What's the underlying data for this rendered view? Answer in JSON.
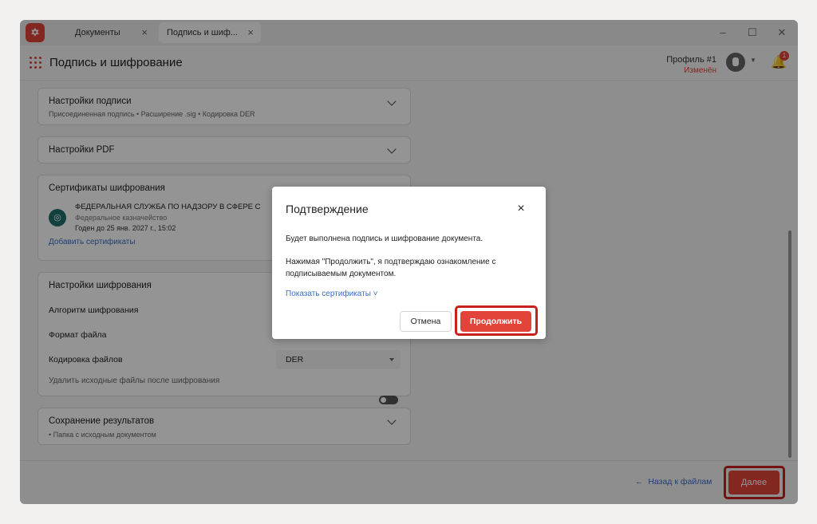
{
  "titlebar": {
    "tabs": [
      {
        "label": "Документы"
      },
      {
        "label": "Подпись и шиф..."
      }
    ],
    "close_glyph": "×"
  },
  "header": {
    "title": "Подпись и шифрование",
    "profile_name": "Профиль #1",
    "profile_status": "Изменён",
    "notification_count": "1"
  },
  "sections": {
    "signature": {
      "title": "Настройки подписи",
      "subtitle": "Присоединенная подпись • Расширение .sig • Кодировка DER"
    },
    "pdf": {
      "title": "Настройки PDF"
    },
    "certificates": {
      "title": "Сертификаты шифрования",
      "cert_name": "ФЕДЕРАЛЬНАЯ СЛУЖБА ПО НАДЗОРУ В СФЕРЕ С",
      "cert_issuer": "Федеральное казначейство",
      "cert_valid": "Годен до 25 янв. 2027 г., 15:02",
      "add_link": "Добавить сертификаты"
    },
    "encryption": {
      "title": "Настройки шифрования",
      "algorithm_label": "Алгоритм шифрования",
      "format_label": "Формат файла",
      "encoding_label": "Кодировка файлов",
      "encoding_value": "DER",
      "delete_label": "Удалить исходные файлы после шифрования"
    },
    "results": {
      "title": "Сохранение результатов",
      "subtitle": "• Папка с исходным документом"
    }
  },
  "footer": {
    "back_label": "Назад к файлам",
    "next_label": "Далее"
  },
  "dialog": {
    "title": "Подтверждение",
    "close_glyph": "×",
    "text1": "Будет выполнена подпись и шифрование документа.",
    "text2": "Нажимая \"Продолжить\", я подтверждаю ознакомление с подписываемым документом.",
    "show_certs": "Показать сертификаты",
    "cancel_label": "Отмена",
    "continue_label": "Продолжить"
  },
  "colors": {
    "accent": "#e2443a",
    "link": "#3a6ec7",
    "highlight": "#c9201e",
    "cert_icon": "#1f6e6a"
  }
}
